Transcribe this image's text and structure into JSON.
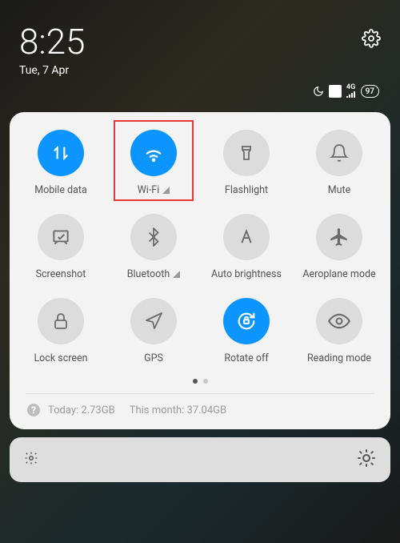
{
  "header": {
    "time": "8:25",
    "date": "Tue, 7 Apr"
  },
  "status": {
    "battery": "97"
  },
  "tiles": {
    "mobile_data": "Mobile data",
    "wifi": "Wi-Fi",
    "flashlight": "Flashlight",
    "mute": "Mute",
    "screenshot": "Screenshot",
    "bluetooth": "Bluetooth",
    "auto_brightness": "Auto brightness",
    "aeroplane_mode": "Aeroplane mode",
    "lock_screen": "Lock screen",
    "gps": "GPS",
    "rotate_off": "Rotate off",
    "reading_mode": "Reading mode"
  },
  "usage": {
    "today_label": "Today:",
    "today_value": "2.73GB",
    "month_label": "This month:",
    "month_value": "37.04GB"
  }
}
